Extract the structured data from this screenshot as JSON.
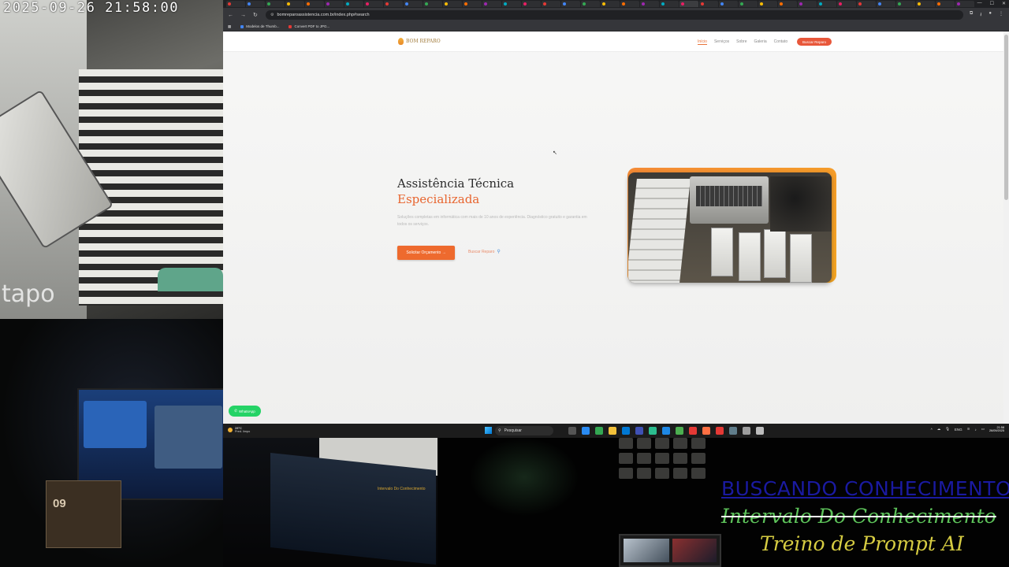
{
  "camera": {
    "timestamp": "2025-09-26  21:58:00",
    "brand": "tapo"
  },
  "browser": {
    "url": "bomreparoassistencia.com.br/index.php#search",
    "tabs_count": 38,
    "active_tab_index": 23,
    "bookmarks": [
      {
        "label": "Modelos de Thumb...",
        "color": "#4285f4"
      },
      {
        "label": "Convert PDF to JPG...",
        "color": "#e53935"
      }
    ]
  },
  "site": {
    "logo_text": "BOM REPARO",
    "nav": [
      "Início",
      "Serviços",
      "Sobre",
      "Galeria",
      "Contato"
    ],
    "nav_current_index": 0,
    "cta_button": "Buscar Reparo",
    "hero": {
      "title_line1": "Assistência Técnica",
      "title_line2": "Especializada",
      "description": "Soluções completas em informática com mais de 10 anos de experiência. Diagnóstico gratuito e garantia em todos os serviços.",
      "primary_button": "Solicitar Orçamento →",
      "secondary_link": "Buscar Reparo"
    },
    "whatsapp_label": "WhatsApp",
    "colors": {
      "accent": "#ee6a2e",
      "whatsapp": "#25d366"
    }
  },
  "taskbar": {
    "weather_temp": "28°C",
    "weather_desc": "Pred. limpo",
    "search_placeholder": "Pesquisar",
    "lang": "ENG",
    "time": "21:58",
    "date": "26/09/2025"
  },
  "overlays": {
    "line1": "BUSCANDO  CONHECIMENTO",
    "line2": "Intervalo Do Conhecimento",
    "line3": "Treino de Prompt AI",
    "mini": "Intervalo Do Conhecimento"
  },
  "scene": {
    "calendar_day": "09"
  }
}
